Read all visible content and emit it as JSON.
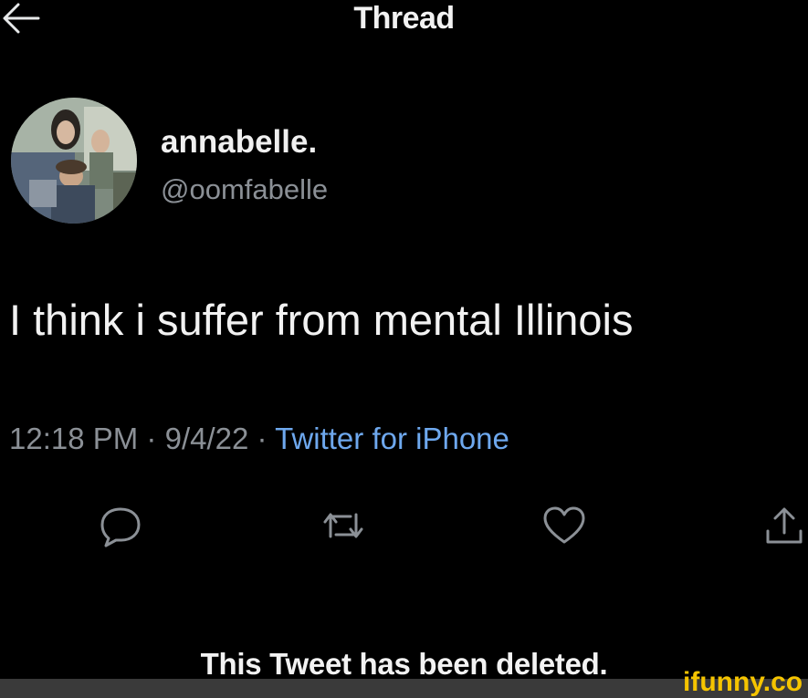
{
  "header": {
    "title": "Thread",
    "back_icon": "arrow-left-icon"
  },
  "author": {
    "display_name": "annabelle.",
    "handle": "@oomfabelle",
    "avatar_icon": "profile-photo"
  },
  "tweet": {
    "text": "I think i suffer from mental Illinois",
    "time": "12:18 PM",
    "separator": "·",
    "date": "9/4/22",
    "source": "Twitter for iPhone"
  },
  "actions": [
    {
      "icon": "reply-icon"
    },
    {
      "icon": "retweet-icon"
    },
    {
      "icon": "like-icon"
    },
    {
      "icon": "share-icon"
    }
  ],
  "footer": {
    "deleted_message": "This Tweet has been deleted.",
    "watermark": "ifunny.co"
  },
  "colors": {
    "background": "#000000",
    "text": "#f2f2f2",
    "secondary_text": "#8b9096",
    "link": "#6ea8ee",
    "watermark": "#f5c400"
  }
}
